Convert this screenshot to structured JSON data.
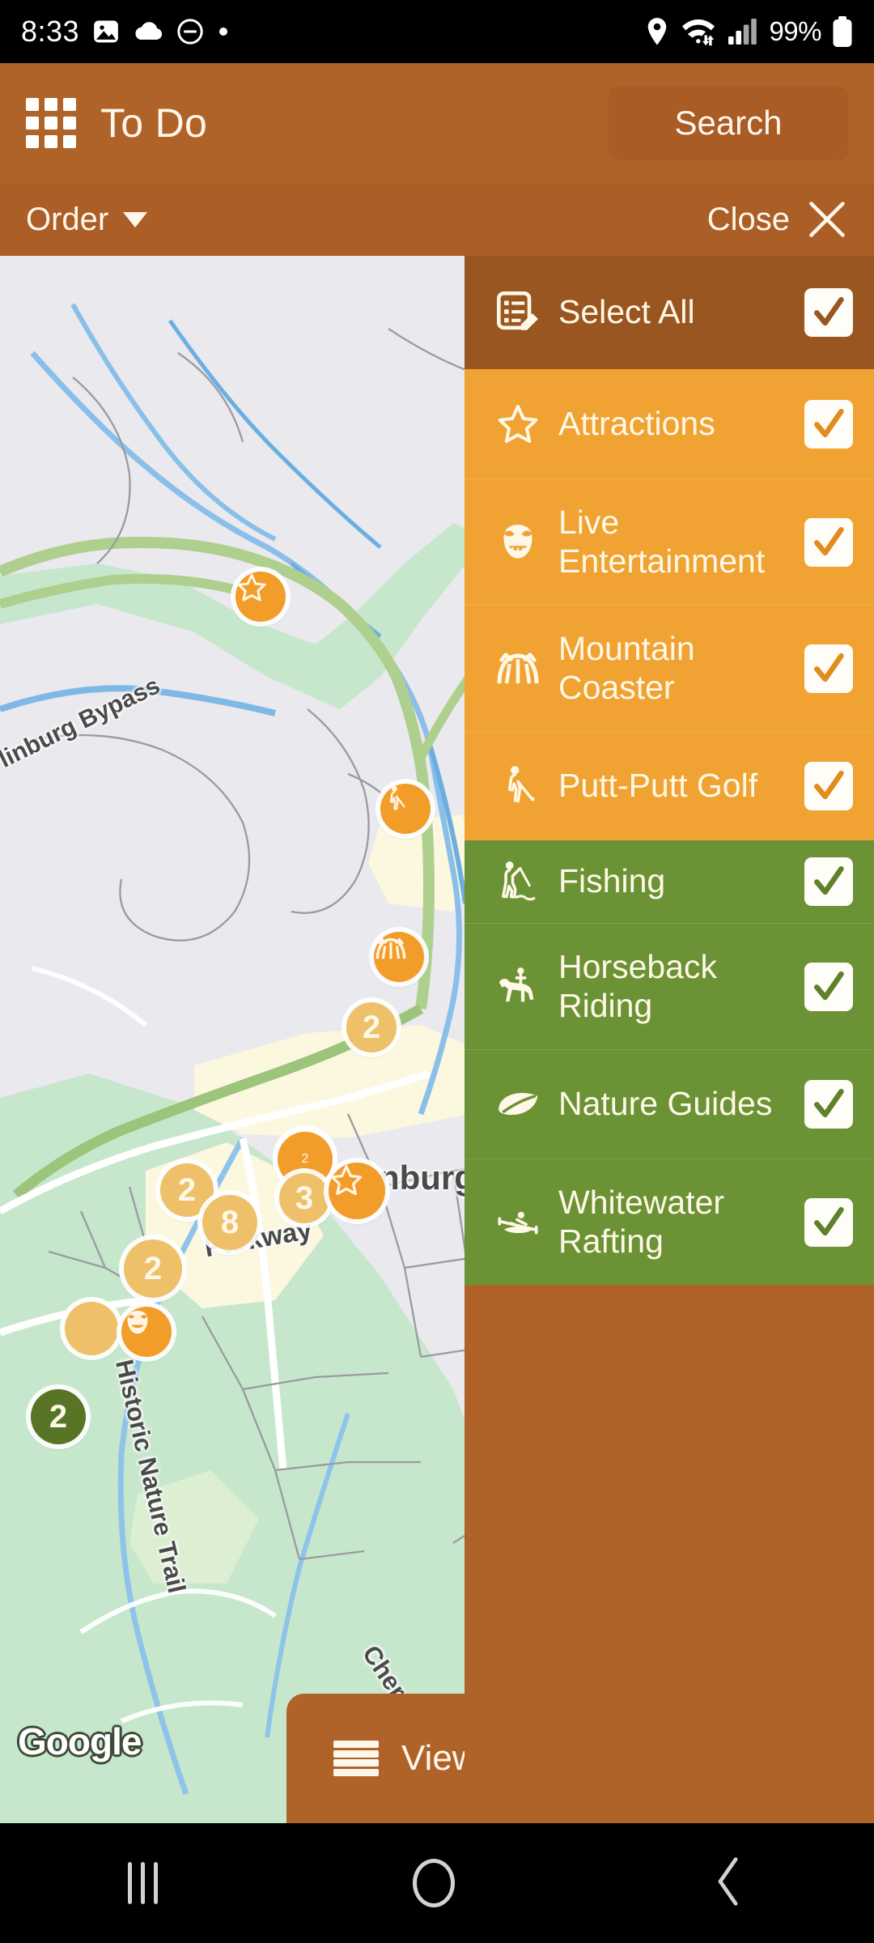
{
  "status_bar": {
    "time": "8:33",
    "battery_percent": "99%",
    "left_icons": [
      "image-icon",
      "cloud-icon",
      "do-not-disturb-icon",
      "dot-icon"
    ],
    "right_icons": [
      "location-pin-icon",
      "wifi-icon",
      "signal-bars-icon",
      "battery-icon"
    ]
  },
  "header": {
    "menu_icon": "grid-menu-icon",
    "title": "To Do",
    "search_label": "Search"
  },
  "order_bar": {
    "order_label": "Order",
    "dropdown_icon": "chevron-down-icon",
    "close_label": "Close",
    "close_icon": "close-x-icon"
  },
  "map": {
    "attribution": "Google",
    "labels": [
      {
        "text": "linburg Bypass"
      },
      {
        "text": "nburg"
      },
      {
        "text": "Parkway"
      },
      {
        "text": "Historic Nature Trail"
      },
      {
        "text": "Cherokee Orch"
      }
    ],
    "markers": [
      {
        "kind": "star-marker",
        "label": ""
      },
      {
        "kind": "golf-marker",
        "label": ""
      },
      {
        "kind": "coaster-marker",
        "label": ""
      },
      {
        "kind": "cluster-marker",
        "label": "2"
      },
      {
        "kind": "cluster-marker",
        "label": "2"
      },
      {
        "kind": "cluster-marker",
        "label": "2"
      },
      {
        "kind": "cluster-marker",
        "label": "2"
      },
      {
        "kind": "cluster-marker",
        "label": "3"
      },
      {
        "kind": "cluster-marker",
        "label": "8"
      },
      {
        "kind": "cluster-marker",
        "label": "2"
      },
      {
        "kind": "star-marker",
        "label": ""
      },
      {
        "kind": "theater-masks-marker",
        "label": ""
      },
      {
        "kind": "cluster-green-marker",
        "label": "2"
      },
      {
        "kind": "leaf-marker",
        "label": ""
      }
    ],
    "view_button_label": "View",
    "view_button_icon": "list-icon",
    "fab_buttons": [
      {
        "icon": "map-layers-icon"
      },
      {
        "icon": "check-icon"
      }
    ]
  },
  "filter_panel": {
    "select_all": {
      "label": "Select All",
      "icon": "list-edit-icon",
      "checked": true
    },
    "groups": [
      {
        "color": "#F0A333",
        "items": [
          {
            "label": "Attractions",
            "icon": "star-icon",
            "checked": true
          },
          {
            "label": "Live Entertainment",
            "icon": "theater-masks-icon",
            "checked": true
          },
          {
            "label": "Mountain Coaster",
            "icon": "roller-coaster-icon",
            "checked": true
          },
          {
            "label": "Putt-Putt Golf",
            "icon": "golfer-icon",
            "checked": true
          }
        ]
      },
      {
        "color": "#6B9234",
        "items": [
          {
            "label": "Fishing",
            "icon": "fishing-icon",
            "checked": true
          },
          {
            "label": "Horseback Riding",
            "icon": "horse-rider-icon",
            "checked": true
          },
          {
            "label": "Nature Guides",
            "icon": "leaf-icon",
            "checked": true
          },
          {
            "label": "Whitewater Rafting",
            "icon": "kayak-icon",
            "checked": true
          }
        ]
      }
    ]
  },
  "nav_bar": {
    "recents_icon": "recents-icon",
    "home_icon": "home-icon",
    "back_icon": "back-icon"
  },
  "colors": {
    "brand_brown": "#B06328",
    "brand_brown_dark": "#9A5621",
    "orange": "#F0A333",
    "green": "#6B9234",
    "map_bg": "#E9E9EE"
  }
}
